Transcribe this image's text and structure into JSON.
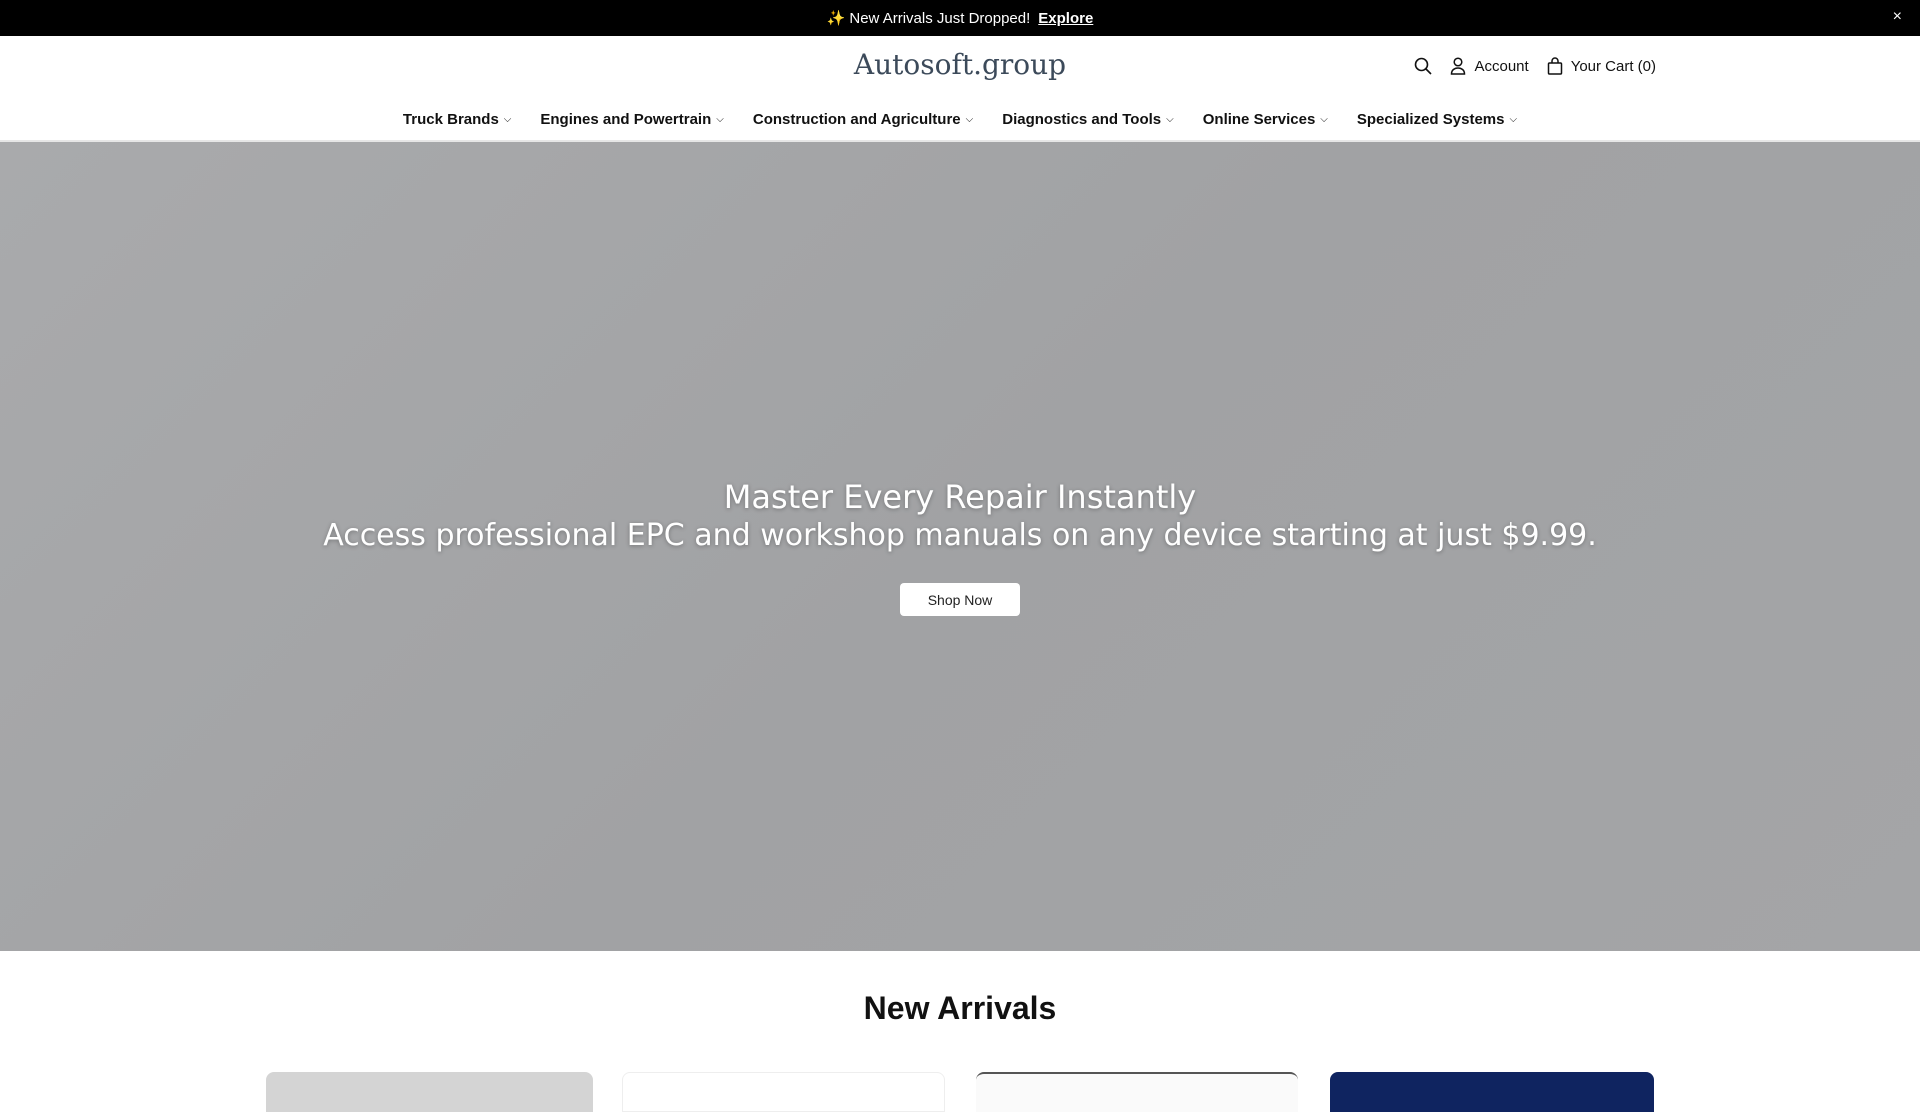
{
  "announcement": {
    "icon": "✨",
    "text": "New Arrivals Just Dropped!",
    "link": "Explore",
    "close": "×"
  },
  "header": {
    "logo": "Autosoft.group",
    "account": "Account",
    "cart": "Your Cart (0)"
  },
  "nav": [
    {
      "label": "Truck Brands"
    },
    {
      "label": "Engines and Powertrain"
    },
    {
      "label": "Construction and Agriculture"
    },
    {
      "label": "Diagnostics and Tools"
    },
    {
      "label": "Online Services"
    },
    {
      "label": "Specialized Systems"
    }
  ],
  "hero": {
    "title": "Master Every Repair Instantly",
    "subtitle": "Access professional EPC and workshop manuals on any device starting at just $9.99.",
    "button": "Shop Now"
  },
  "new_arrivals": {
    "heading": "New Arrivals"
  }
}
